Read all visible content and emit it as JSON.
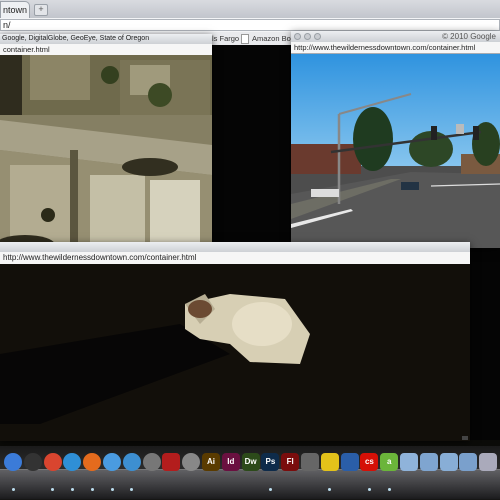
{
  "main_window": {
    "tab_title": "ntown",
    "new_tab_glyph": "+",
    "address_text": "n/",
    "bookmarks": [
      {
        "label": "ls Fargo",
        "icon": "page-icon"
      },
      {
        "label": "Amazon Bookm",
        "icon": "page-icon"
      }
    ]
  },
  "aerial_window": {
    "title": "Google, DigitalGlobe, GeoEye, State of Oregon",
    "url": "container.html"
  },
  "street_window": {
    "copyright": "© 2010 Google",
    "url": "http://www.thewildernessdowntown.com/container.html"
  },
  "bottom_window": {
    "url": "http://www.thewildernessdowntown.com/container.html"
  },
  "dock": {
    "items": [
      {
        "name": "finder-icon",
        "label": "",
        "color": "#3b7bd8"
      },
      {
        "name": "dashboard-icon",
        "label": "",
        "color": "#333"
      },
      {
        "name": "chrome-icon",
        "label": "",
        "color": "#d9452f"
      },
      {
        "name": "safari-icon",
        "label": "",
        "color": "#2f8fd6"
      },
      {
        "name": "firefox-icon",
        "label": "",
        "color": "#e46b1d"
      },
      {
        "name": "ichat-icon",
        "label": "",
        "color": "#4a9be0"
      },
      {
        "name": "itunes-icon",
        "label": "",
        "color": "#3d8fd1"
      },
      {
        "name": "photo-icon",
        "label": "",
        "color": "#777"
      },
      {
        "name": "red-app-icon",
        "label": "",
        "color": "#b31d1d"
      },
      {
        "name": "system-prefs-icon",
        "label": "",
        "color": "#888"
      },
      {
        "name": "illustrator-icon",
        "label": "Ai",
        "color": "#5a3b00"
      },
      {
        "name": "indesign-icon",
        "label": "Id",
        "color": "#6a1040"
      },
      {
        "name": "dreamweaver-icon",
        "label": "Dw",
        "color": "#2c4a1a"
      },
      {
        "name": "photoshop-icon",
        "label": "Ps",
        "color": "#0e2b4a"
      },
      {
        "name": "flash-icon",
        "label": "Fl",
        "color": "#7a0d0d"
      },
      {
        "name": "image-capture-icon",
        "label": "",
        "color": "#666"
      },
      {
        "name": "cyberduck-icon",
        "label": "",
        "color": "#e3c21a"
      },
      {
        "name": "arrow-app-icon",
        "label": "",
        "color": "#2a5ea8"
      },
      {
        "name": "lastfm-icon",
        "label": "cs",
        "color": "#d51007"
      },
      {
        "name": "adium-icon",
        "label": "a",
        "color": "#6bb53a"
      },
      {
        "name": "folder-icon",
        "label": "",
        "color": "#8fb3da"
      },
      {
        "name": "downloads-folder-icon",
        "label": "",
        "color": "#7fa5d0"
      },
      {
        "name": "documents-folder-icon",
        "label": "",
        "color": "#88aed6"
      },
      {
        "name": "stack-folder-icon",
        "label": "",
        "color": "#7aa0cc"
      },
      {
        "name": "trash-icon",
        "label": "",
        "color": "#aab"
      }
    ]
  }
}
